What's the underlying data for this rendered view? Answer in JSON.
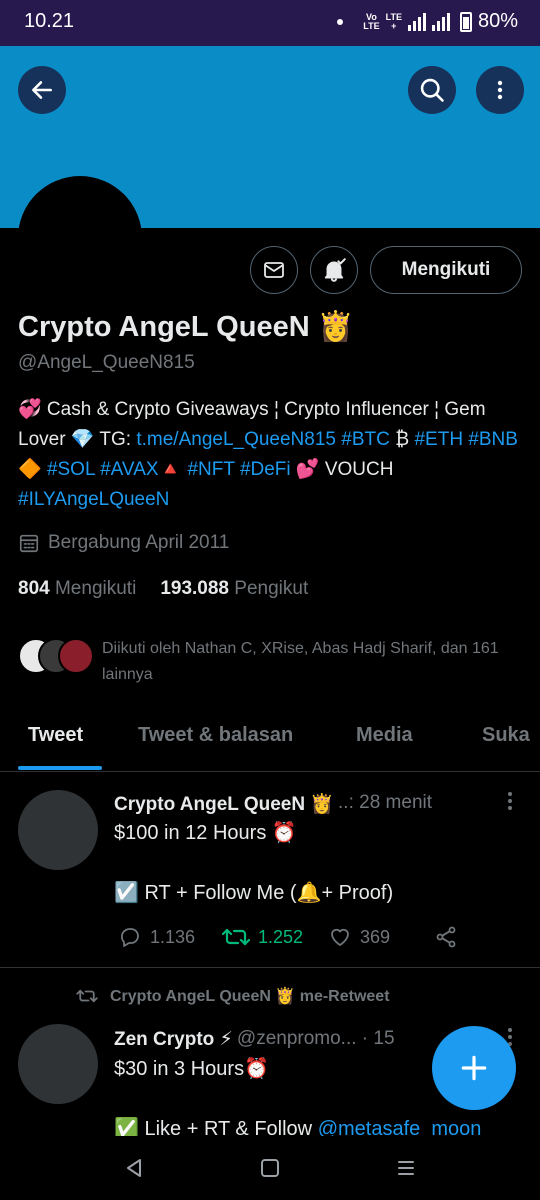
{
  "status_bar": {
    "time": "10.21",
    "volte_top": "Vo",
    "volte_bottom": "LTE",
    "lte_top": "LTE",
    "lte_bottom": "+",
    "battery": "80%"
  },
  "profile": {
    "name": "Crypto AngeL QueeN 👸",
    "handle": "@AngeL_QueeN815",
    "bio": {
      "part1": "💞 Cash & Crypto Giveaways ¦ Crypto Influencer ¦ Gem Lover 💎 TG: ",
      "link1": "t.me/AngeL_QueeN815",
      "tag_btc": "#BTC",
      "emoji_btc": " ₿ ",
      "tag_eth_bnb": "#ETH #BNB",
      "emoji_bnb": " 🔶 ",
      "tag_sol_avax": "#SOL #AVAX",
      "emoji_avax": "🔺 ",
      "tag_nft": "#NFT",
      "tag_defi": "#DeFi",
      "emoji_defi": " 💕 VOUCH ",
      "tag_ily": "#ILYAngeLQueeN"
    },
    "joined": "Bergabung April 2011",
    "following_count": "804",
    "following_label": "Mengikuti",
    "followers_count": "193.088",
    "followers_label": "Pengikut",
    "followed_by": "Diikuti oleh Nathan C, XRise, Abas Hadj Sharif, dan 161 lainnya",
    "follow_button": "Mengikuti"
  },
  "tabs": [
    "Tweet",
    "Tweet & balasan",
    "Media",
    "Suka"
  ],
  "tweets": [
    {
      "author": "Crypto AngeL QueeN 👸",
      "meta": "..: 28 menit",
      "line1": "$100 in 12 Hours ⏰",
      "line2": "☑️ RT + Follow Me (🔔+ Proof)",
      "replies": "1.136",
      "retweets": "1.252",
      "likes": "369"
    },
    {
      "retweet_label": "Crypto AngeL QueeN 👸 me-Retweet",
      "author": "Zen Crypto ⚡",
      "meta": "@zenpromo... · 15",
      "line1": "$30 in 3 Hours⏰",
      "line2_prefix": "✅ Like + RT & Follow ",
      "line2_link": "@metasafe_moon"
    }
  ],
  "colors": {
    "accent": "#1d9bf0",
    "banner": "#0a8dc7",
    "retweet_green": "#00ba7c",
    "status_bar": "#27194e"
  },
  "icons": [
    "back-arrow-icon",
    "search-icon",
    "more-vertical-icon",
    "mail-icon",
    "bell-icon",
    "calendar-icon",
    "reply-icon",
    "retweet-icon",
    "like-icon",
    "share-icon",
    "plus-icon"
  ]
}
